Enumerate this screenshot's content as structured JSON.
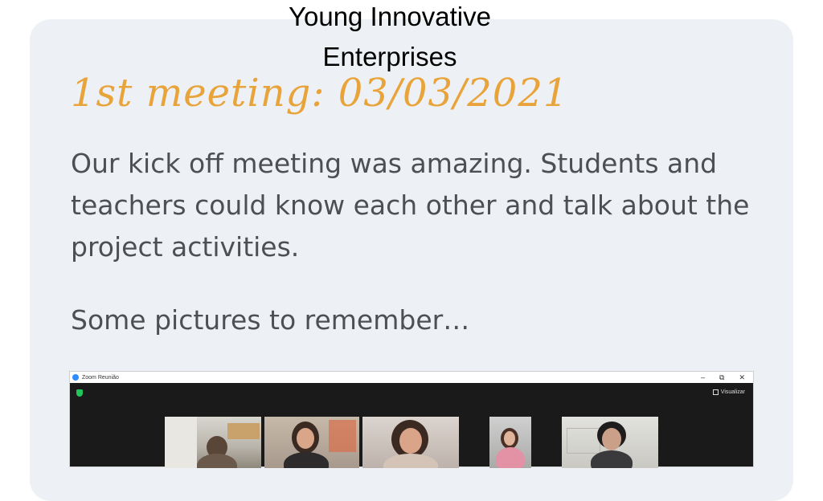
{
  "header": {
    "title": "Young Innovative Enterprises"
  },
  "post": {
    "heading": "1st meeting: 03/03/2021",
    "body": "Our kick off meeting was amazing. Students and teachers could know each other and talk about the project activities.",
    "closing": "Some pictures to remember…"
  },
  "screenshot": {
    "window_title": "Zoom Reunião",
    "view_label": "Visualizar",
    "controls": {
      "minimize": "–",
      "restore": "⧉",
      "close": "✕"
    }
  },
  "colors": {
    "heading": "#e8a43a",
    "body_text": "#4d4f52",
    "card_background": "#edf1f5",
    "zoom_background": "#1a1a1a"
  }
}
